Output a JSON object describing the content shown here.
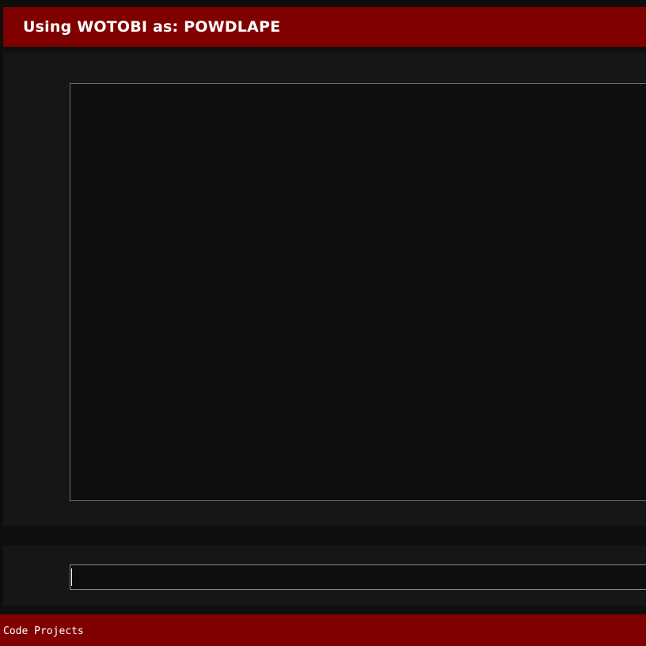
{
  "header": {
    "title": "Using WOTOBI as: POWDLAPE"
  },
  "console": {
    "output_text": ""
  },
  "command": {
    "value": "",
    "placeholder": ""
  },
  "footer": {
    "link_label": "Code Projects"
  },
  "colors": {
    "accent": "#800000",
    "background": "#0e0e0e",
    "panel": "#161616",
    "border": "#6e6e6e",
    "text": "#ffffff"
  }
}
